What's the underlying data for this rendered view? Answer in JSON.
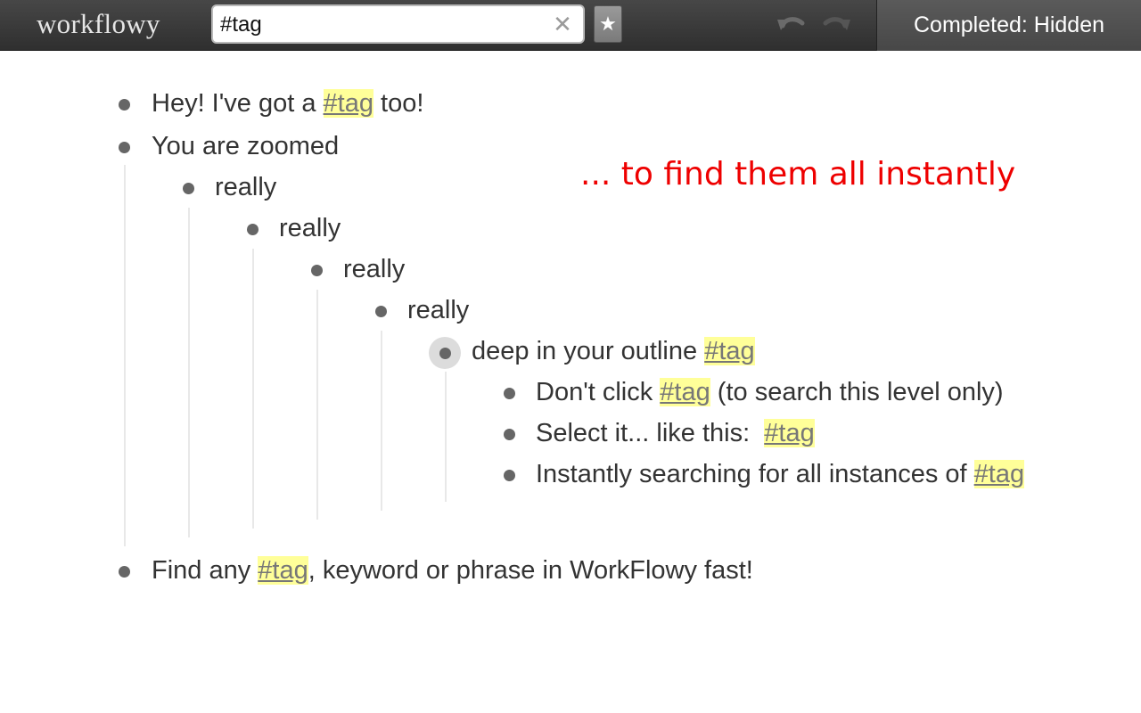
{
  "header": {
    "logo": "workflowy",
    "search": {
      "value": "#tag",
      "clear_glyph": "✕"
    },
    "star_glyph": "★",
    "completed_label": "Completed: Hidden"
  },
  "colors": {
    "header_bg": "#3a3a3a",
    "tag_highlight": "#ffff99",
    "callout": "#ee0000",
    "bullet": "#666666"
  },
  "outline": {
    "item1": {
      "before": "Hey! I've got a ",
      "tag": "#tag",
      "after": " too!"
    },
    "item2": {
      "text": "You are zoomed"
    },
    "really1": "really",
    "really2": "really",
    "really3": "really",
    "really4": "really",
    "deep": {
      "before": "deep in your outline ",
      "tag": "#tag"
    },
    "child1": {
      "before": "Don't click ",
      "tag": "#tag",
      "after": " (to search this level only)"
    },
    "child2": {
      "before": "Select it... like this:  ",
      "tag": "#tag"
    },
    "child3": {
      "before": "Instantly searching for all instances of ",
      "tag": "#tag"
    },
    "item3": {
      "before": "Find any ",
      "tag": "#tag",
      "after": ", keyword or phrase in WorkFlowy fast!"
    }
  },
  "callout": "... to find them all instantly"
}
